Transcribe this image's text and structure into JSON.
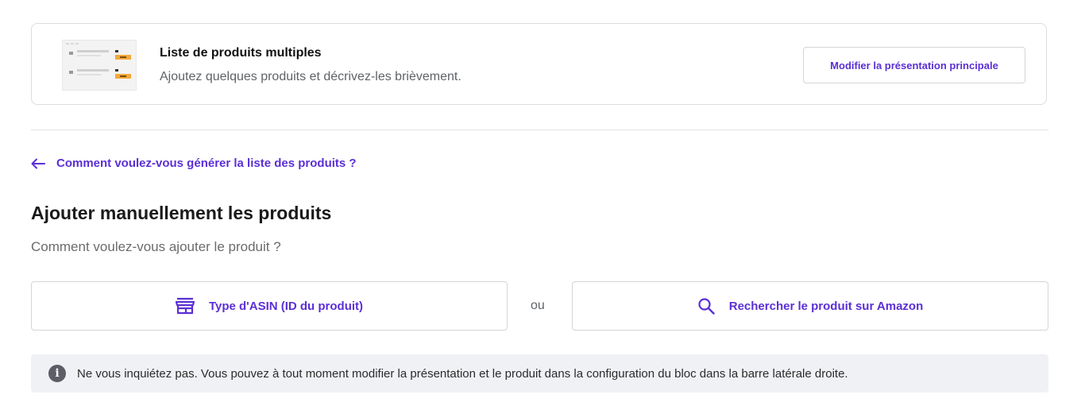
{
  "layout_card": {
    "title": "Liste de produits multiples",
    "description": "Ajoutez quelques produits et décrivez-les brièvement.",
    "modify_button": "Modifier la présentation principale",
    "thumbnail_icon": "product-list-thumbnail"
  },
  "back_link": {
    "icon": "arrow-left-icon",
    "label": "Comment voulez-vous générer la liste des produits ?"
  },
  "section": {
    "title": "Ajouter manuellement les produits",
    "subtitle": "Comment voulez-vous ajouter le produit ?"
  },
  "options": {
    "asin": {
      "icon": "store-icon",
      "label": "Type d'ASIN (ID du produit)"
    },
    "or_label": "ou",
    "search": {
      "icon": "search-icon",
      "label": "Rechercher le produit sur Amazon"
    }
  },
  "info": {
    "icon": "info-icon",
    "text": "Ne vous inquiétez pas. Vous pouvez à tout moment modifier la présentation et le produit dans la configuration du bloc dans la barre latérale droite."
  },
  "colors": {
    "accent": "#5b2fd6",
    "info_bg": "#f0f1f5"
  }
}
